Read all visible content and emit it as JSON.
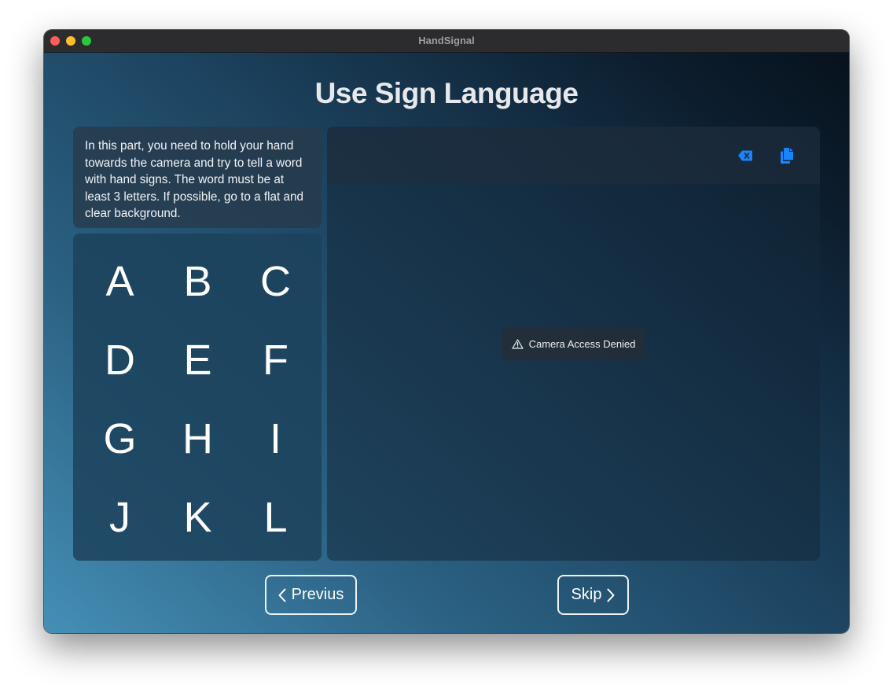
{
  "window": {
    "title": "HandSignal"
  },
  "page": {
    "title": "Use Sign Language",
    "instructions": "In this part, you need to hold your hand towards the camera and try to tell a word with hand signs. The word must be at least 3 letters. If possible, go to a flat and clear background."
  },
  "letters": [
    "A",
    "B",
    "C",
    "D",
    "E",
    "F",
    "G",
    "H",
    "I",
    "J",
    "K",
    "L"
  ],
  "camera": {
    "status": "Camera Access Denied",
    "status_icon": "warning-triangle-icon"
  },
  "toolbar": {
    "delete_icon": "delete-backward-icon",
    "copy_icon": "copy-document-icon",
    "accent_color": "#1a84ff"
  },
  "navigation": {
    "previous_label": "Previus",
    "skip_label": "Skip"
  }
}
